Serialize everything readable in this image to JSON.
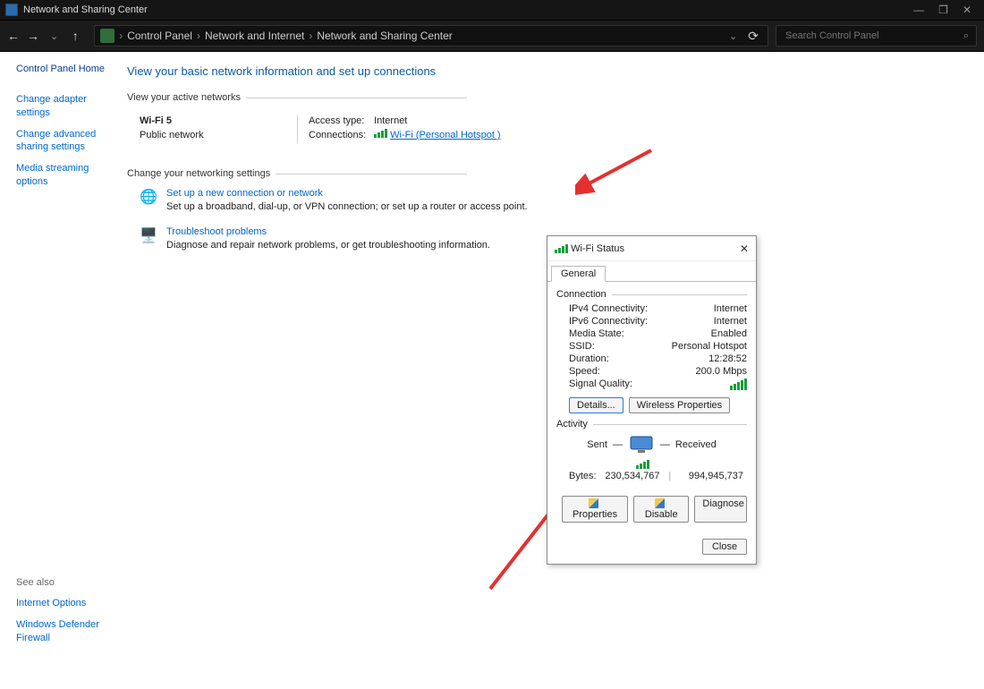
{
  "window": {
    "title": "Network and Sharing Center",
    "minimize": "—",
    "maximize": "❐",
    "close": "✕"
  },
  "nav": {
    "back": "←",
    "forward": "→",
    "dropdown": "⌄",
    "up": "↑",
    "crumb1": "Control Panel",
    "crumb2": "Network and Internet",
    "crumb3": "Network and Sharing Center",
    "sep": "›",
    "refresh": "⟳",
    "search_placeholder": "Search Control Panel",
    "more": "⌄"
  },
  "sidebar": {
    "home": "Control Panel Home",
    "link1": "Change adapter settings",
    "link2": "Change advanced sharing settings",
    "link3": "Media streaming options",
    "see_label": "See also",
    "see1": "Internet Options",
    "see2": "Windows Defender Firewall"
  },
  "main": {
    "title": "View your basic network information and set up connections",
    "section1": "View your active networks",
    "net_name": "Wi-Fi 5",
    "net_type": "Public network",
    "access_label": "Access type:",
    "access_value": "Internet",
    "conn_label": "Connections:",
    "conn_value": "Wi-Fi (Personal Hotspot )",
    "section2": "Change your networking settings",
    "setup_link": "Set up a new connection or network",
    "setup_desc": "Set up a broadband, dial-up, or VPN connection; or set up a router or access point.",
    "trouble_link": "Troubleshoot problems",
    "trouble_desc": "Diagnose and repair network problems, or get troubleshooting information."
  },
  "dialog": {
    "title": "Wi-Fi Status",
    "close": "✕",
    "tab": "General",
    "grp_conn": "Connection",
    "ipv4_k": "IPv4 Connectivity:",
    "ipv4_v": "Internet",
    "ipv6_k": "IPv6 Connectivity:",
    "ipv6_v": "Internet",
    "media_k": "Media State:",
    "media_v": "Enabled",
    "ssid_k": "SSID:",
    "ssid_v": "Personal Hotspot",
    "dur_k": "Duration:",
    "dur_v": "12:28:52",
    "speed_k": "Speed:",
    "speed_v": "200.0 Mbps",
    "sig_k": "Signal Quality:",
    "btn_details": "Details...",
    "btn_wireless": "Wireless Properties",
    "grp_act": "Activity",
    "sent": "Sent",
    "received": "Received",
    "dash": "—",
    "bytes_k": "Bytes:",
    "bytes_sent": "230,534,767",
    "bytes_recv": "994,945,737",
    "btn_props": "Properties",
    "btn_disable": "Disable",
    "btn_diag": "Diagnose",
    "btn_close": "Close"
  }
}
